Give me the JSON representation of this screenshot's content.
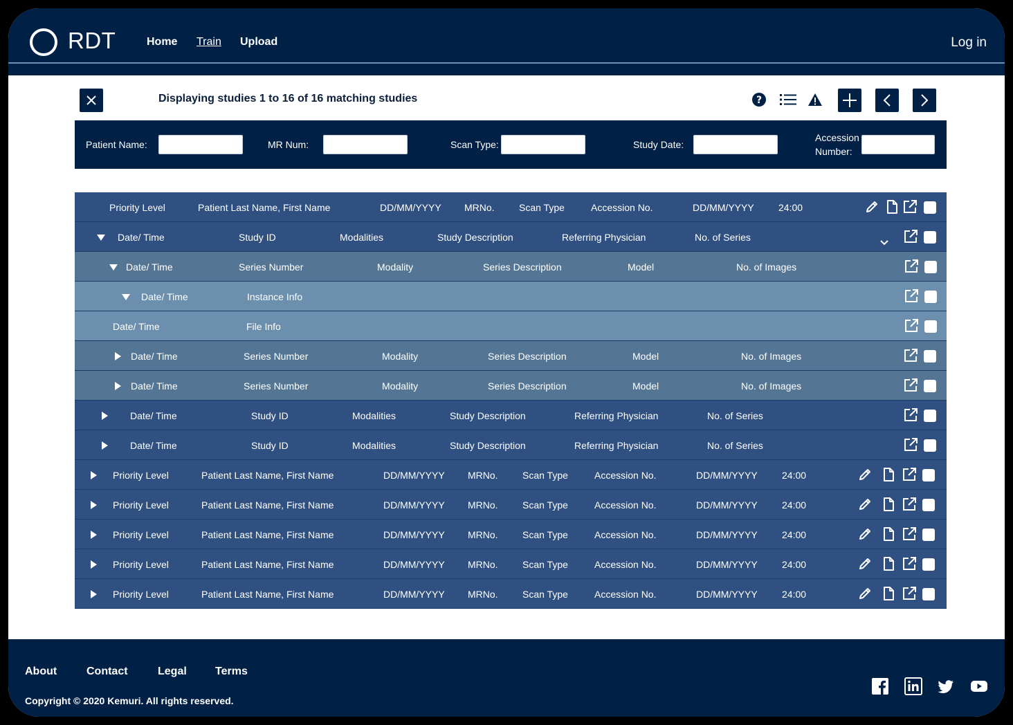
{
  "header": {
    "logo_text": "RDT",
    "nav": [
      {
        "label": "Home"
      },
      {
        "label": "Train"
      },
      {
        "label": "Upload"
      }
    ],
    "login_label": "Log in"
  },
  "toolbar": {
    "status": "Displaying studies 1 to 16 of 16 matching studies",
    "icons": [
      "close-icon",
      "help-icon",
      "list-icon",
      "warning-icon",
      "add-icon",
      "prev-icon",
      "next-icon"
    ]
  },
  "filters": {
    "patient_name": {
      "label": "Patient Name:",
      "value": ""
    },
    "mr_num": {
      "label": "MR Num:",
      "value": ""
    },
    "scan_type": {
      "label": "Scan Type:",
      "value": ""
    },
    "study_date": {
      "label": "Study Date:",
      "value": ""
    },
    "accession_line1": "Accession",
    "accession_line2": "Number:",
    "accession": {
      "value": ""
    }
  },
  "rows": {
    "patient": {
      "priority": "Priority Level",
      "name": "Patient Last Name, First Name",
      "dob": "DD/MM/YYYY",
      "mrno": "MRNo.",
      "scan_type": "Scan Type",
      "accession": "Accession No.",
      "date": "DD/MM/YYYY",
      "time": "24:00"
    },
    "study": {
      "datetime": "Date/ Time",
      "study_id": "Study ID",
      "modalities": "Modalities",
      "description": "Study Description",
      "physician": "Referring Physician",
      "series_count": "No. of Series"
    },
    "series": {
      "datetime": "Date/ Time",
      "series_number": "Series Number",
      "modality": "Modality",
      "description": "Series Description",
      "model": "Model",
      "image_count": "No. of Images"
    },
    "instance": {
      "datetime": "Date/ Time",
      "info": "Instance Info"
    },
    "file": {
      "datetime": "Date/ Time",
      "info": "File Info"
    }
  },
  "footer": {
    "links": [
      {
        "label": "About"
      },
      {
        "label": "Contact"
      },
      {
        "label": "Legal"
      },
      {
        "label": "Terms"
      }
    ],
    "copyright": "Copyright © 2020 Kemuri. All rights reserved.",
    "social_icons": [
      "facebook-icon",
      "linkedin-icon",
      "twitter-icon",
      "youtube-icon"
    ]
  },
  "colors": {
    "navy": "#002046",
    "row_study": "#2f5080",
    "row_series": "#547694",
    "row_instance": "#6b8fad"
  }
}
